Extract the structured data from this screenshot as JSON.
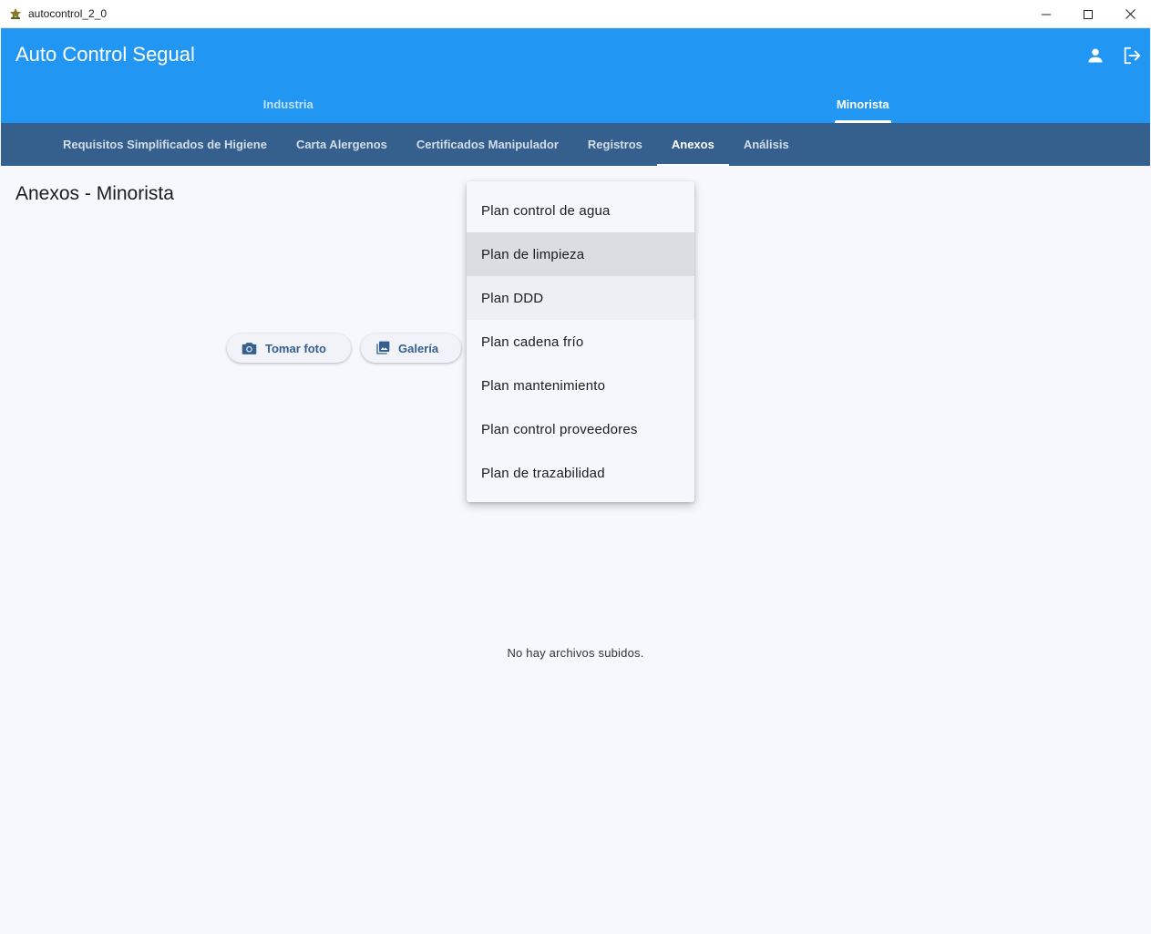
{
  "window": {
    "title": "autocontrol_2_0"
  },
  "appbar": {
    "title": "Auto Control Segual",
    "main_tabs": [
      {
        "label": "Industria"
      },
      {
        "label": "Minorista"
      }
    ]
  },
  "subtabs": [
    {
      "label": "Requisitos Simplificados de Higiene"
    },
    {
      "label": "Carta Alergenos"
    },
    {
      "label": "Certificados Manipulador"
    },
    {
      "label": "Registros"
    },
    {
      "label": "Anexos"
    },
    {
      "label": "Análisis"
    }
  ],
  "page": {
    "title": "Anexos - Minorista",
    "take_photo_label": "Tomar foto",
    "gallery_label": "Galería",
    "empty_message": "No hay archivos subidos."
  },
  "dropdown": {
    "items": [
      {
        "label": "Plan control de agua"
      },
      {
        "label": "Plan de limpieza"
      },
      {
        "label": "Plan DDD"
      },
      {
        "label": "Plan cadena frío"
      },
      {
        "label": "Plan mantenimiento"
      },
      {
        "label": "Plan control proveedores"
      },
      {
        "label": "Plan de trazabilidad"
      }
    ]
  },
  "colors": {
    "appbar": "#2196f3",
    "subtabs": "#35608e",
    "background": "#f7f8fd",
    "accent_text": "#35608e"
  }
}
